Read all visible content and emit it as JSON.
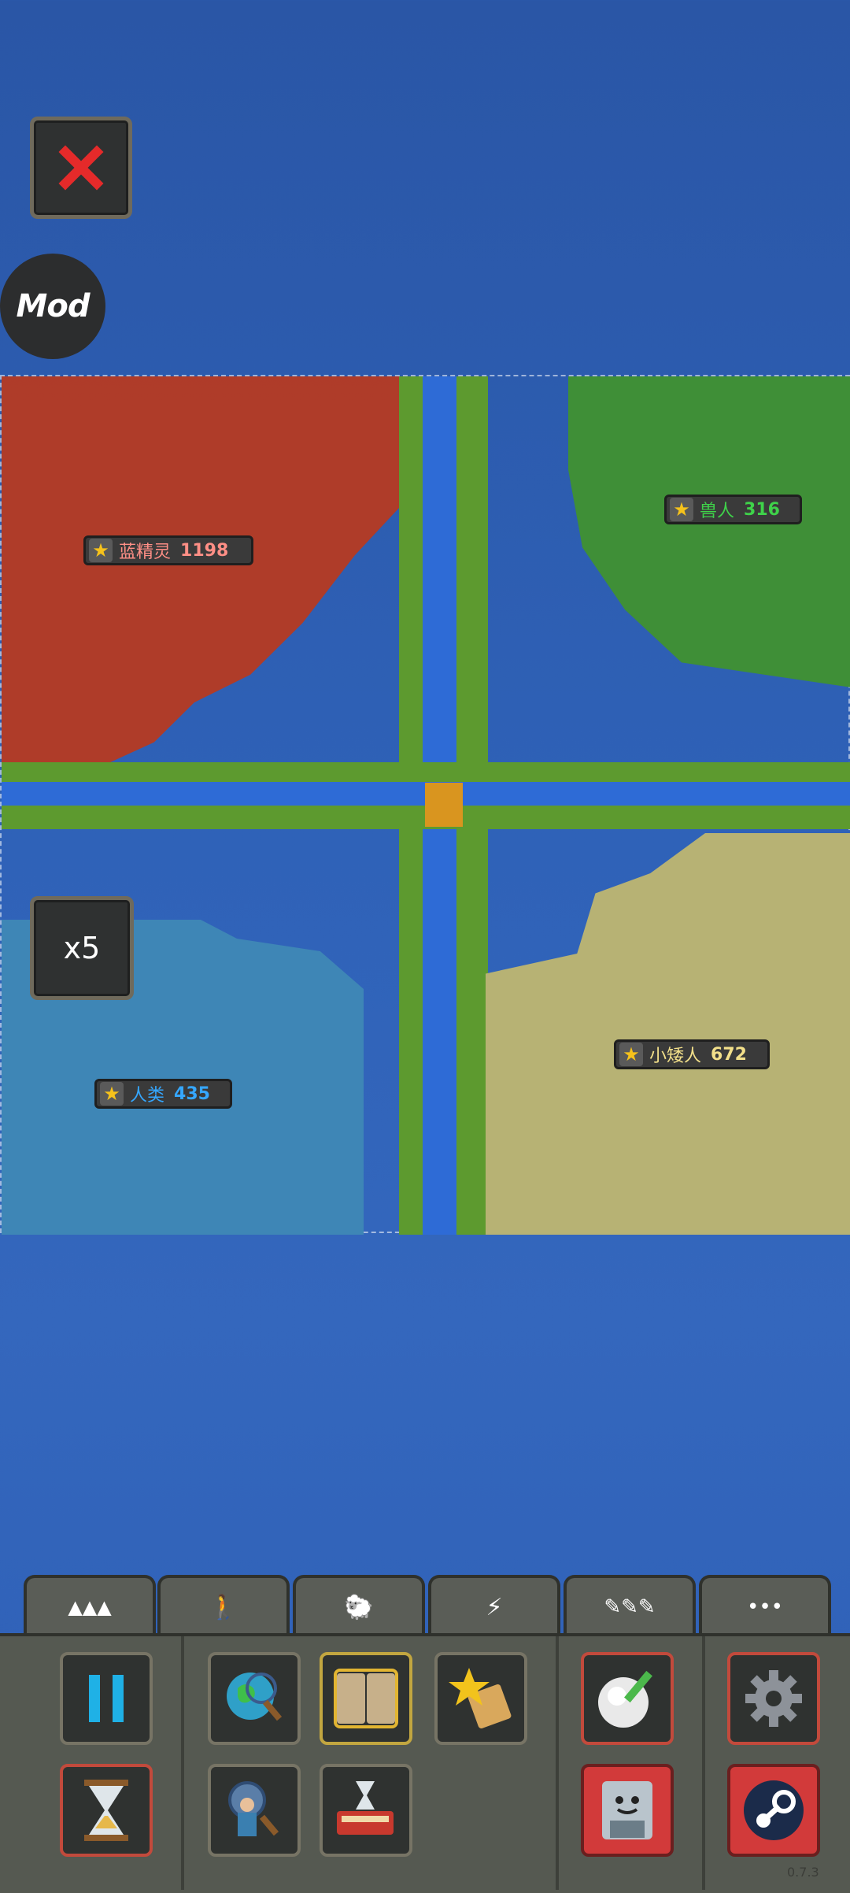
{
  "buttons": {
    "close_icon": "close-icon",
    "mod_label": "Mod",
    "speed_label": "x5"
  },
  "kingdoms": [
    {
      "race": "蓝精灵",
      "population": "1198",
      "color": "#ff8f86"
    },
    {
      "race": "兽人",
      "population": "316",
      "color": "#3fd24a"
    },
    {
      "race": "人类",
      "population": "435",
      "color": "#35a7ff"
    },
    {
      "race": "小矮人",
      "population": "672",
      "color": "#f3e08a"
    }
  ],
  "tabs": [
    {
      "icon": "mountains-icon",
      "glyph": "▲▲▲"
    },
    {
      "icon": "human-icon",
      "glyph": "🚶"
    },
    {
      "icon": "animal-icon",
      "glyph": "🐑"
    },
    {
      "icon": "disaster-icon",
      "glyph": "⚡"
    },
    {
      "icon": "drawing-tools-icon",
      "glyph": "✎✎✎"
    },
    {
      "icon": "more-icon",
      "glyph": "•••"
    }
  ],
  "tools": {
    "pause_icon": "pause-icon",
    "world_info_icon": "world-info-icon",
    "history_book_icon": "history-book-icon",
    "achievements_icon": "achievements-icon",
    "edit_icon": "edit-pencil-icon",
    "settings_icon": "gear-icon",
    "time_icon": "hourglass-icon",
    "unit_search_icon": "unit-search-icon",
    "world_laws_icon": "world-laws-icon",
    "save_icon": "save-icon",
    "steam_icon": "steam-icon"
  },
  "version": "0.7.3"
}
